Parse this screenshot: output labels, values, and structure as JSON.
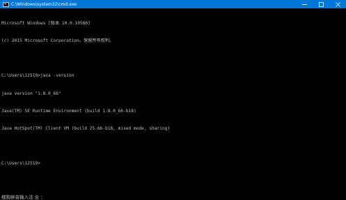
{
  "window": {
    "title": "C:\\Windows\\system32\\cmd.exe",
    "icon": "cmd-icon",
    "controls": {
      "minimize": "—",
      "maximize": "☐",
      "close": "✕"
    }
  },
  "console": {
    "lines": [
      "Microsoft Windows [版本 10.0.10586]",
      "(c) 2015 Microsoft Corporation。保留所有权利。",
      "",
      "C:\\Users\\12519>java -version",
      "java version \"1.8.0_66\"",
      "Java(TM) SE Runtime Environment (build 1.8.0_66-b18)",
      "Java HotSpot(TM) Client VM (build 25.66-b18, mixed mode, sharing)",
      "",
      "C:\\Users\\12519>"
    ]
  },
  "ime_status": "搜狗拼音输入法 全 ："
}
